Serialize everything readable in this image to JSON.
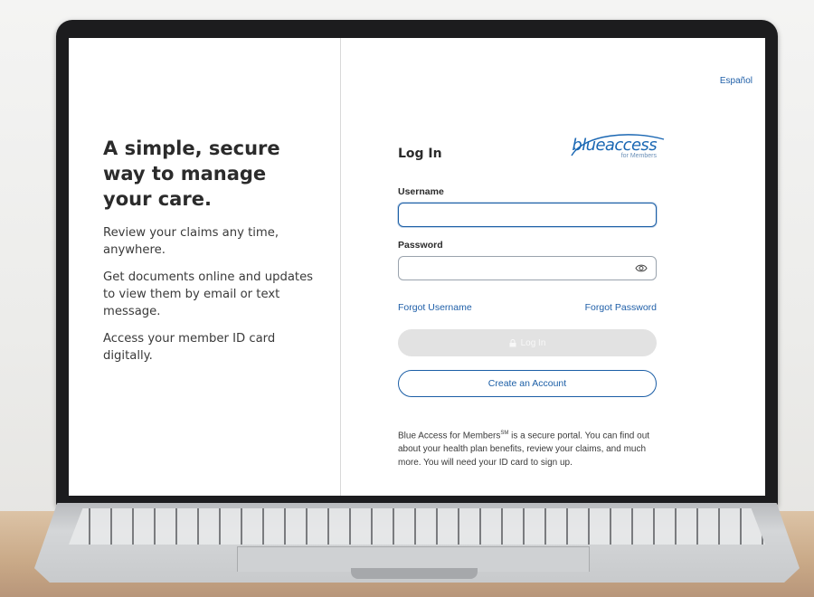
{
  "language_link": "Español",
  "left_panel": {
    "headline": "A simple, secure way to manage your care.",
    "paragraphs": [
      "Review your claims any time, anywhere.",
      "Get documents online and updates to view them by email or text message.",
      "Access your member ID card digitally."
    ]
  },
  "login": {
    "title": "Log In",
    "logo": {
      "wordmark": "blueaccess",
      "subtitle": "for Members"
    },
    "username_label": "Username",
    "username_value": "",
    "password_label": "Password",
    "password_value": "",
    "forgot_username": "Forgot Username",
    "forgot_password": "Forgot Password",
    "login_button": "Log In",
    "create_account_button": "Create an Account",
    "disclaimer_prefix": "Blue Access for Members",
    "disclaimer_mark": "SM",
    "disclaimer_suffix": " is a secure portal. You can find out about your health plan benefits, review your claims, and much more. You will need your ID card to sign up."
  },
  "icons": {
    "password_toggle": "eye-icon",
    "login_lock": "lock-icon"
  },
  "colors": {
    "link_blue": "#1f5fa8",
    "brand_blue": "#1a67b3",
    "disabled_button": "#e2e2e2",
    "text_dark": "#2b2b2b"
  }
}
